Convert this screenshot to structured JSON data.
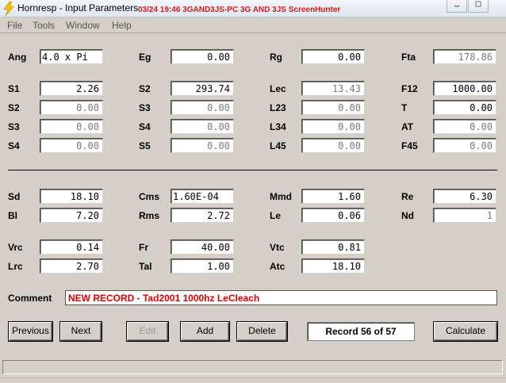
{
  "window": {
    "title": "Hornresp - Input Parameters",
    "watermark": "03/24 19:46 3GAND3JS-PC 3G AND 3JS ScreenHunter"
  },
  "menu": [
    "File",
    "Tools",
    "Window",
    "Help"
  ],
  "params": {
    "ang": {
      "label": "Ang",
      "value": "4.0 x Pi"
    },
    "eg": {
      "label": "Eg",
      "value": "0.00"
    },
    "rg": {
      "label": "Rg",
      "value": "0.00"
    },
    "fta": {
      "label": "Fta",
      "value": "178.86"
    },
    "s1": {
      "label": "S1",
      "value": "2.26"
    },
    "s2r": {
      "label": "S2",
      "value": "293.74"
    },
    "lec": {
      "label": "Lec",
      "value": "13.43"
    },
    "f12": {
      "label": "F12",
      "value": "1000.00"
    },
    "s2": {
      "label": "S2",
      "value": "0.00"
    },
    "s3r": {
      "label": "S3",
      "value": "0.00"
    },
    "l23": {
      "label": "L23",
      "value": "0.00"
    },
    "t": {
      "label": "T",
      "value": "0.00"
    },
    "s3": {
      "label": "S3",
      "value": "0.00"
    },
    "s4r": {
      "label": "S4",
      "value": "0.00"
    },
    "l34": {
      "label": "L34",
      "value": "0.00"
    },
    "at": {
      "label": "AT",
      "value": "0.00"
    },
    "s4": {
      "label": "S4",
      "value": "0.00"
    },
    "s5": {
      "label": "S5",
      "value": "0.00"
    },
    "l45": {
      "label": "L45",
      "value": "0.00"
    },
    "f45": {
      "label": "F45",
      "value": "0.00"
    },
    "sd": {
      "label": "Sd",
      "value": "18.10"
    },
    "cms": {
      "label": "Cms",
      "value": "1.60E-04"
    },
    "mmd": {
      "label": "Mmd",
      "value": "1.60"
    },
    "re": {
      "label": "Re",
      "value": "6.30"
    },
    "bl": {
      "label": "Bl",
      "value": "7.20"
    },
    "rms": {
      "label": "Rms",
      "value": "2.72"
    },
    "le": {
      "label": "Le",
      "value": "0.06"
    },
    "nd": {
      "label": "Nd",
      "value": "1"
    },
    "vrc": {
      "label": "Vrc",
      "value": "0.14"
    },
    "fr": {
      "label": "Fr",
      "value": "40.00"
    },
    "vtc": {
      "label": "Vtc",
      "value": "0.81"
    },
    "lrc": {
      "label": "Lrc",
      "value": "2.70"
    },
    "tal": {
      "label": "Tal",
      "value": "1.00"
    },
    "atc": {
      "label": "Atc",
      "value": "18.10"
    }
  },
  "comment": {
    "label": "Comment",
    "value": "NEW RECORD - Tad2001 1000hz LeCleach"
  },
  "buttons": {
    "previous": "Previous",
    "next": "Next",
    "edit": "Edit",
    "add": "Add",
    "delete": "Delete",
    "calculate": "Calculate"
  },
  "record": "Record 56 of 57",
  "colors": {
    "background": "#d4d0c8",
    "comment_text": "#e00000",
    "watermark": "#d61a1a"
  }
}
